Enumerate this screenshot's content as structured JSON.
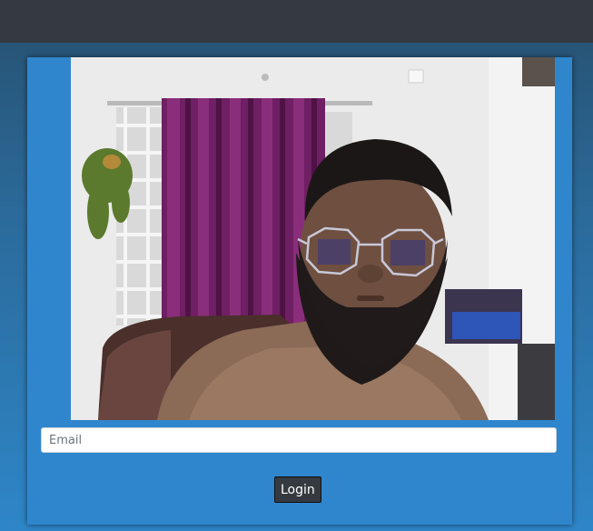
{
  "form": {
    "email_placeholder": "Email",
    "email_value": "",
    "login_label": "Login"
  },
  "colors": {
    "navbar": "#343a40",
    "card": "#2f86cd",
    "button": "#343a40"
  }
}
